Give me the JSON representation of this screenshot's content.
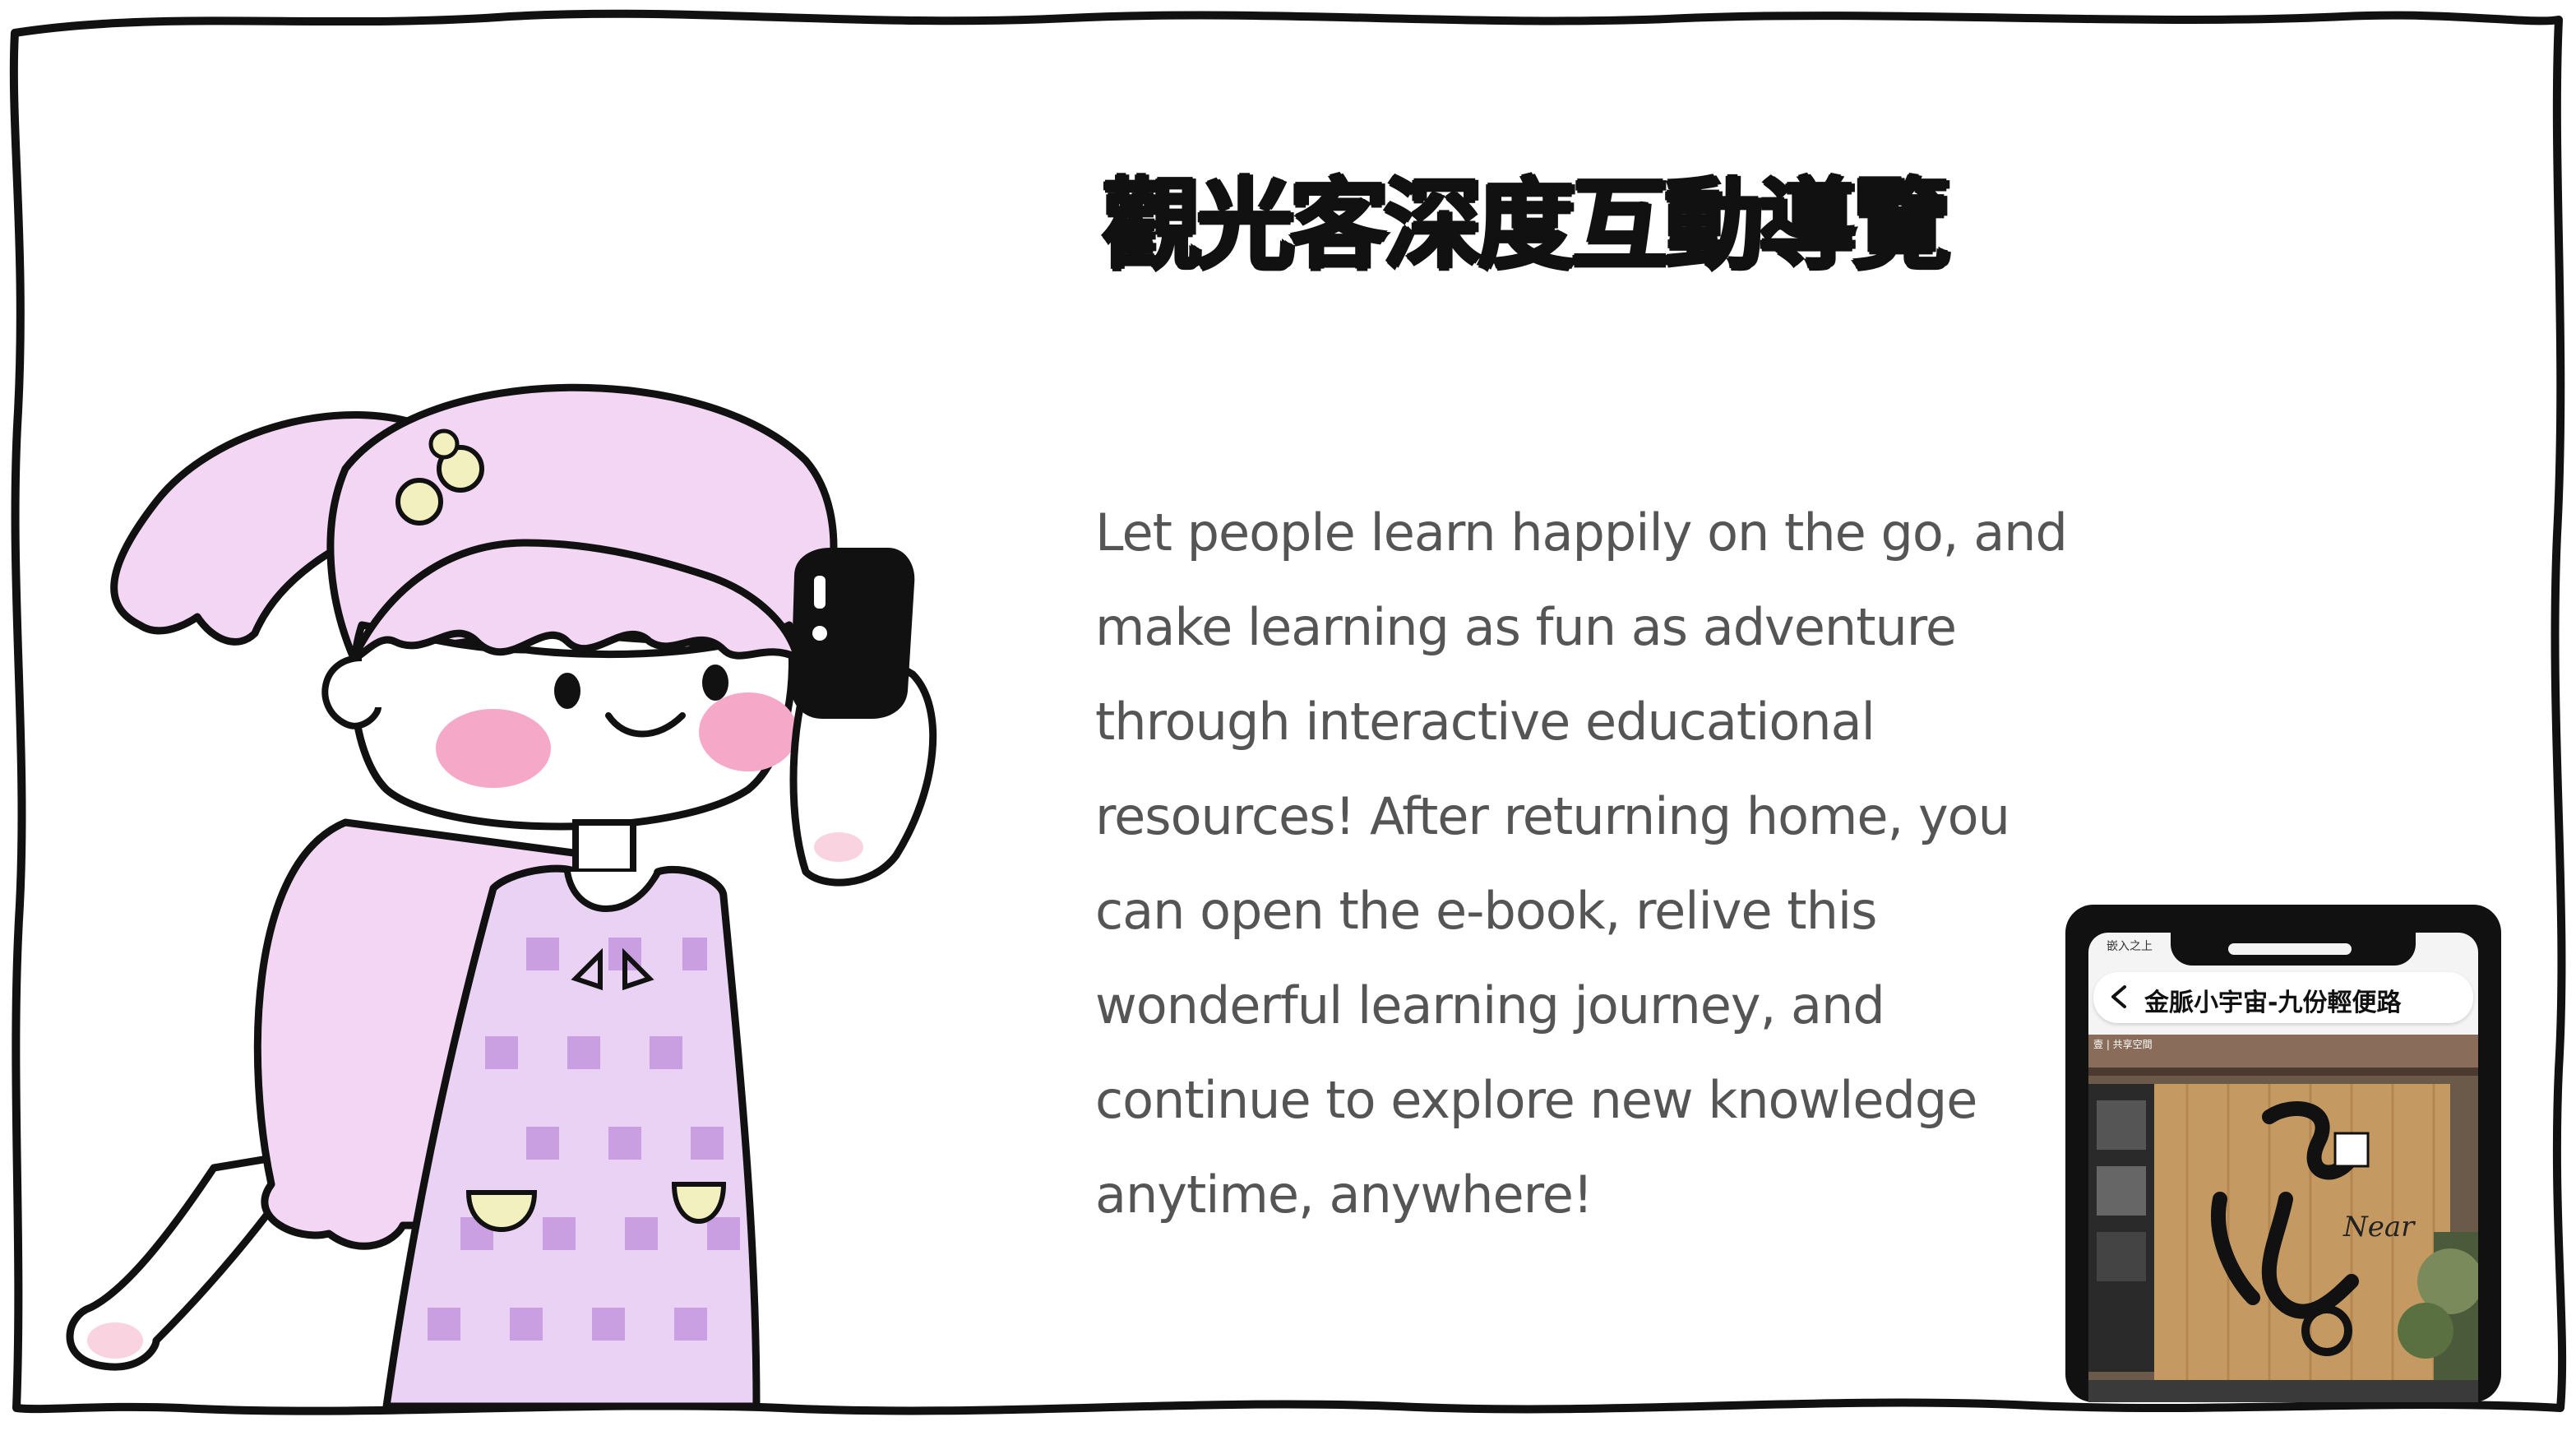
{
  "slide": {
    "title": "觀光客深度互動導覽",
    "paragraph_lines": [
      "Let people learn happily on the go, and",
      "make learning as fun as adventure",
      "through interactive educational",
      "resources!  After returning home, you",
      "can open the e-book, relive this",
      "wonderful learning journey, and",
      "continue to explore new knowledge",
      "anytime, anywhere!"
    ]
  },
  "phone": {
    "status_text": "嵌入之上",
    "header_title": "金脈小宇宙-九份輕便路",
    "back_icon": "chevron-left-icon",
    "photo_caption": "壹 | 共享空間",
    "shop_sign": "Near"
  },
  "illustration": {
    "subject": "girl-taking-selfie-icon"
  },
  "colors": {
    "title": "#111111",
    "body_text": "#555555",
    "hair": "#f3d6f3",
    "dress": "#d6b0e8",
    "cheek": "#f5a8c8",
    "outline": "#111111"
  }
}
